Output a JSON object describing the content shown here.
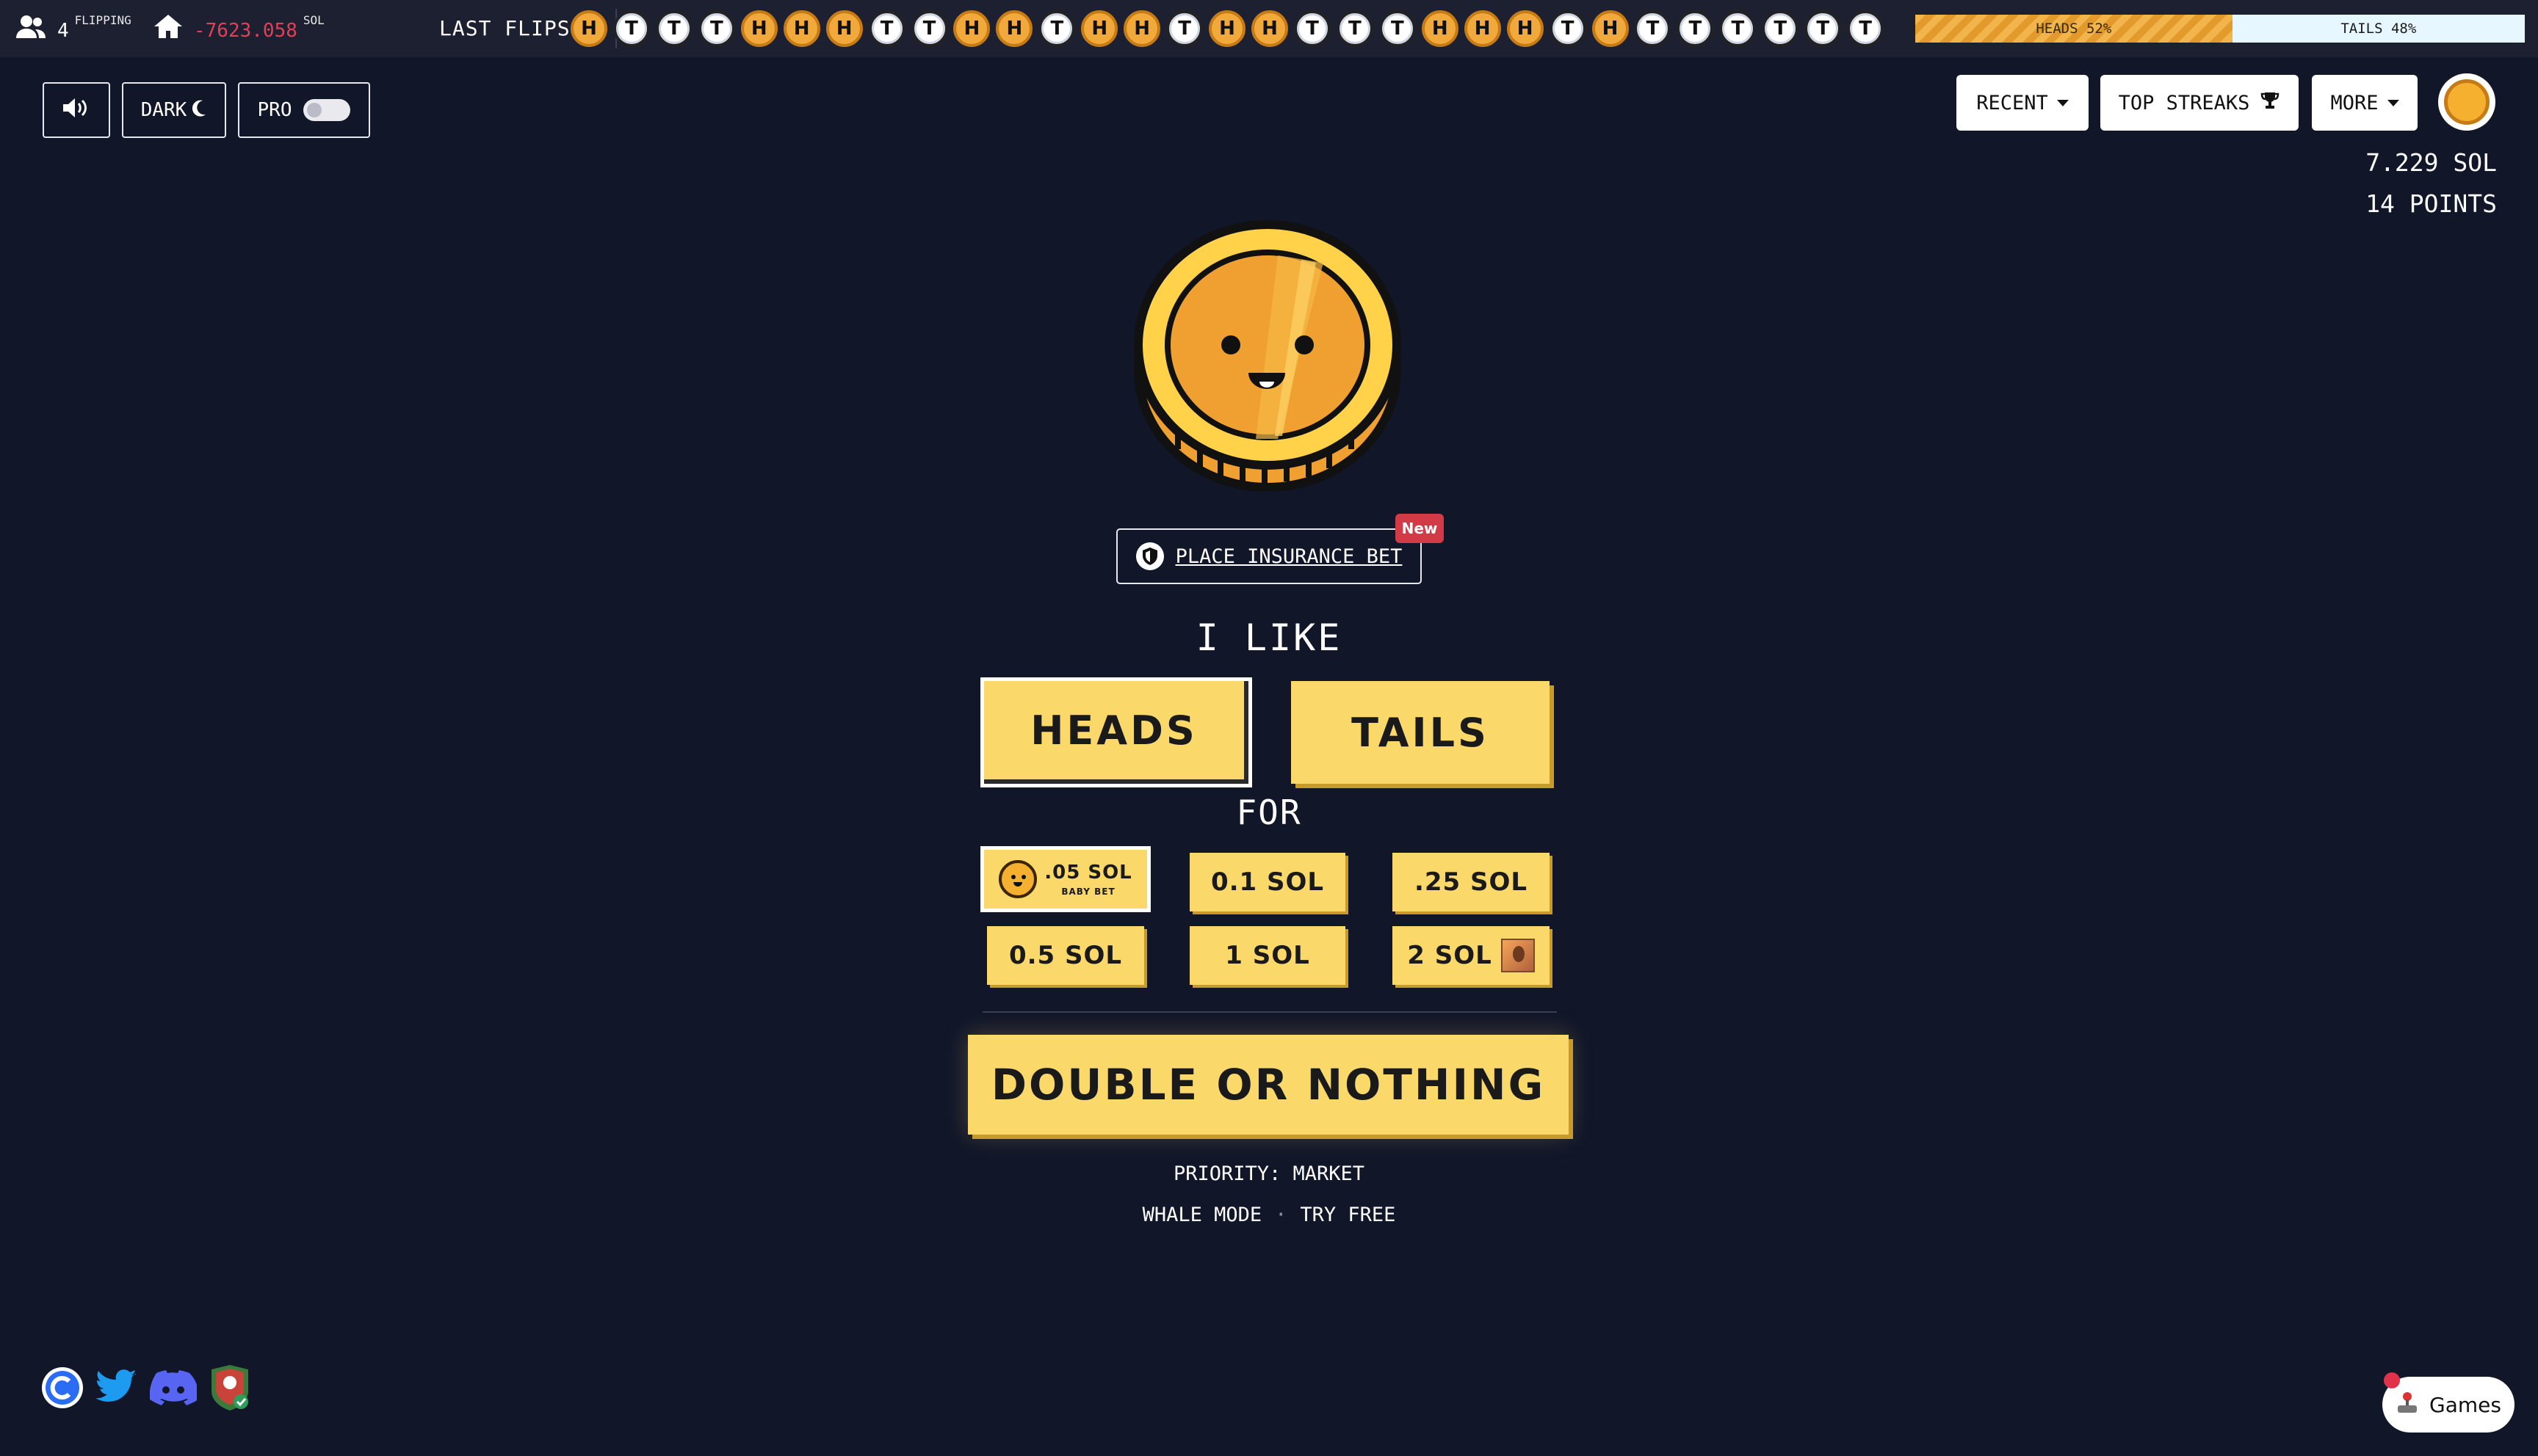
{
  "topbar": {
    "flipping_count": "4",
    "flipping_label": "FLIPPING",
    "house_pnl": "-7623.058",
    "house_pnl_unit": "SOL",
    "last_flips_label": "LAST FLIPS",
    "last_flips": [
      "H",
      "T",
      "T",
      "T",
      "H",
      "H",
      "H",
      "T",
      "T",
      "H",
      "H",
      "T",
      "H",
      "H",
      "T",
      "H",
      "H",
      "T",
      "T",
      "T",
      "H",
      "H",
      "H",
      "T",
      "H",
      "T",
      "T",
      "T",
      "T",
      "T",
      "T"
    ],
    "heads_pct_label": "HEADS 52%",
    "tails_pct_label": "TAILS 48%",
    "heads_fraction": 0.52
  },
  "controls": {
    "dark_label": "DARK",
    "pro_label": "PRO",
    "pro_enabled": false
  },
  "menu": {
    "recent_label": "RECENT",
    "top_streaks_label": "TOP STREAKS",
    "more_label": "MORE"
  },
  "account": {
    "balance": "7.229 SOL",
    "points": "14 POINTS"
  },
  "insurance": {
    "label": "PLACE INSURANCE BET",
    "badge": "New"
  },
  "bet": {
    "ilike_label": "I LIKE",
    "heads_label": "HEADS",
    "tails_label": "TAILS",
    "selected_side": "heads",
    "for_label": "FOR",
    "amounts": [
      {
        "label": ".05 SOL",
        "sub": "BABY BET",
        "selected": true
      },
      {
        "label": "0.1 SOL"
      },
      {
        "label": ".25 SOL"
      },
      {
        "label": "0.5 SOL"
      },
      {
        "label": "1 SOL"
      },
      {
        "label": "2 SOL"
      }
    ],
    "double_or_nothing_label": "DOUBLE OR NOTHING"
  },
  "footer": {
    "priority": "PRIORITY: MARKET",
    "whale_mode": "WHALE MODE",
    "dot": "·",
    "try_free": "TRY FREE"
  },
  "games": {
    "label": "Games"
  },
  "colors": {
    "background": "#111629",
    "button_yellow": "#fbd86a",
    "coin_orange": "#f5b030",
    "loss_red": "#e0405a"
  },
  "icons": [
    "users-icon",
    "home-icon",
    "speaker-icon",
    "moon-icon",
    "trophy-icon",
    "shield-icon",
    "coin-icon",
    "cronos-icon",
    "twitter-icon",
    "discord-icon",
    "badge-icon",
    "joystick-icon"
  ]
}
